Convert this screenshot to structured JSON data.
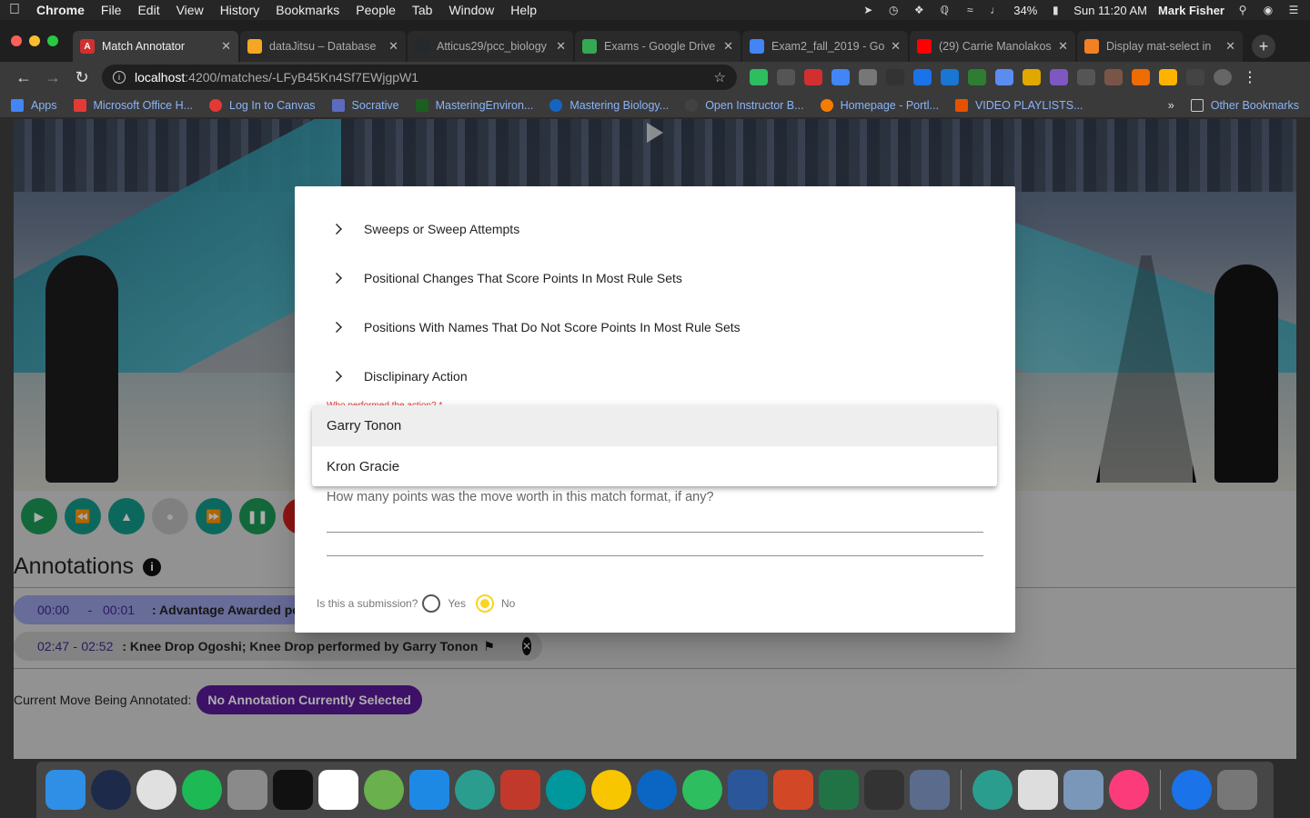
{
  "menubar": {
    "app_name": "Chrome",
    "items": [
      "File",
      "Edit",
      "View",
      "History",
      "Bookmarks",
      "People",
      "Tab",
      "Window",
      "Help"
    ],
    "battery": "34%",
    "clock": "Sun 11:20 AM",
    "user": "Mark Fisher"
  },
  "tabs": [
    {
      "title": "Match Annotator",
      "favicon_color": "#d32f2f",
      "favicon_glyph": "A"
    },
    {
      "title": "dataJitsu – Database",
      "favicon_color": "#f5a623",
      "favicon_glyph": ""
    },
    {
      "title": "Atticus29/pcc_biology",
      "favicon_color": "#24292e",
      "favicon_glyph": ""
    },
    {
      "title": "Exams - Google Drive",
      "favicon_color": "#34a853",
      "favicon_glyph": ""
    },
    {
      "title": "Exam2_fall_2019 - Google",
      "favicon_color": "#4285f4",
      "favicon_glyph": ""
    },
    {
      "title": "(29) Carrie Manolakos",
      "favicon_color": "#ff0000",
      "favicon_glyph": ""
    },
    {
      "title": "Display mat-select in",
      "favicon_color": "#f48024",
      "favicon_glyph": ""
    }
  ],
  "omnibox": {
    "host": "localhost",
    "path": ":4200/matches/-LFyB45Kn4Sf7EWjgpW1"
  },
  "bookmarks": [
    {
      "label": "Apps",
      "color": "#4285f4"
    },
    {
      "label": "Microsoft Office H...",
      "color": "#e53935"
    },
    {
      "label": "Log In to Canvas",
      "color": "#e53935"
    },
    {
      "label": "Socrative",
      "color": "#5c6bc0"
    },
    {
      "label": "MasteringEnviron...",
      "color": "#1b5e20"
    },
    {
      "label": "Mastering Biology...",
      "color": "#1565c0"
    },
    {
      "label": "Open Instructor B...",
      "color": "#424242"
    },
    {
      "label": "Homepage - Portl...",
      "color": "#f57c00"
    },
    {
      "label": "VIDEO PLAYLISTS...",
      "color": "#e65100"
    }
  ],
  "other_bookmarks": "Other Bookmarks",
  "dialog": {
    "tree_items": [
      "Sweeps or Sweep Attempts",
      "Positional Changes That Score Points In Most Rule Sets",
      "Positions With Names That Do Not Score Points In Most Rule Sets",
      "Disclipinary Action"
    ],
    "performer_label": "Who performed the action? *",
    "points_placeholder": "How many points was the move worth in this match format, if any?",
    "submission_question": "Is this a submission?",
    "submission_options": [
      "Yes",
      "No"
    ],
    "submission_selected": "No"
  },
  "select_panel": {
    "options": [
      "Garry Tonon",
      "Kron Gracie"
    ]
  },
  "annotations": {
    "title": "Annotations",
    "rows": [
      {
        "start": "00:00",
        "end": "00:01",
        "desc": ": Advantage Awarded perf"
      },
      {
        "start": "02:47",
        "end": "02:52",
        "desc": ": Knee Drop Ogoshi; Knee Drop performed by Garry Tonon"
      }
    ],
    "current_label": "Current Move Being Annotated:",
    "current_chip": "No Annotation Currently Selected"
  },
  "colors": {
    "accent_purple": "#5a1a9a",
    "player_green": "#1b9a56",
    "radio_yellow": "#f9d423"
  }
}
